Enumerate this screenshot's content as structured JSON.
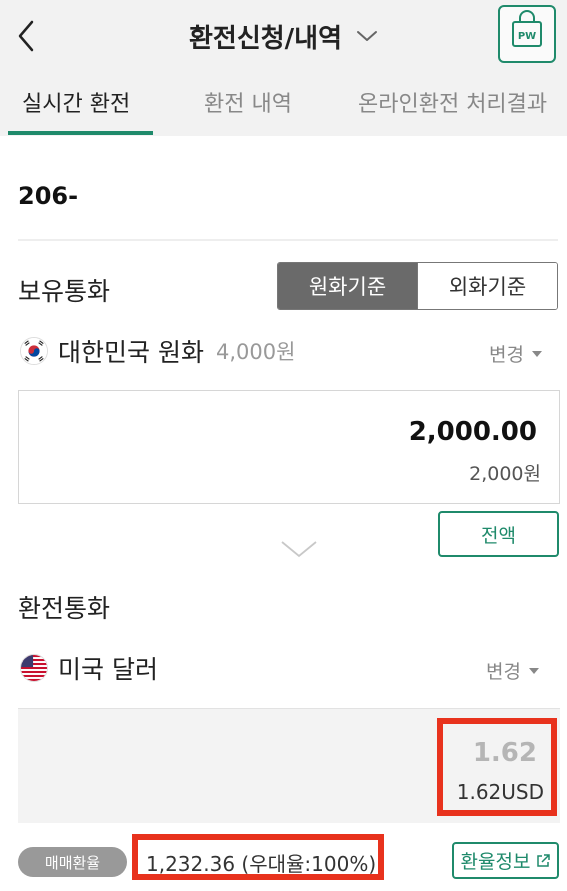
{
  "header": {
    "title": "환전신청/내역",
    "pw_label": "PW"
  },
  "tabs": [
    {
      "label": "실시간 환전",
      "active": true
    },
    {
      "label": "환전 내역",
      "active": false
    },
    {
      "label": "온라인환전 처리결과",
      "active": false
    }
  ],
  "account": {
    "number": "206-"
  },
  "holding": {
    "section_title": "보유통화",
    "toggle": [
      "원화기준",
      "외화기준"
    ],
    "selected_toggle": "원화기준",
    "currency_name": "대한민국 원화",
    "balance": "4,000원",
    "change_label": "변경",
    "amount": "2,000.00",
    "amount_sub": "2,000원",
    "full_amount_label": "전액"
  },
  "exchange": {
    "section_title": "환전통화",
    "currency_name": "미국 달러",
    "change_label": "변경",
    "amount": "1.62",
    "amount_sub": "1.62USD"
  },
  "rate": {
    "badge": "매매환율",
    "value": "1,232.36 (우대율:100%)",
    "info_label": "환율정보"
  },
  "colors": {
    "accent": "#1f8a6b",
    "highlight": "#e8321d",
    "segment_active": "#6a6a6a"
  }
}
